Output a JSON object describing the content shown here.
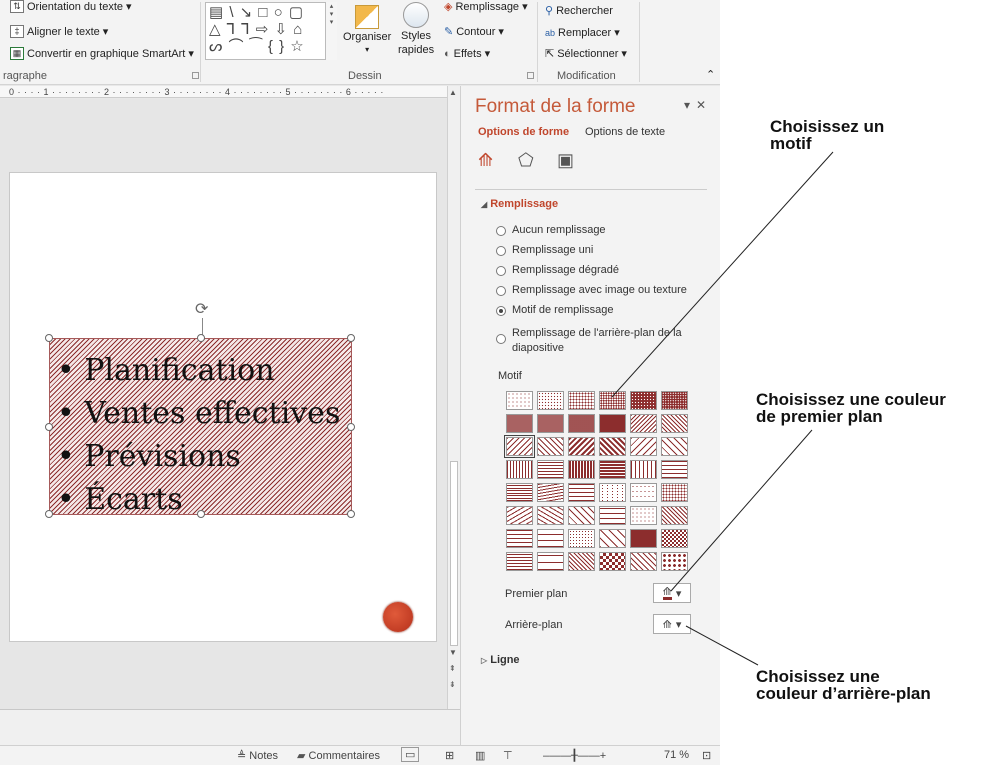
{
  "ribbon": {
    "orientation": "Orientation du texte",
    "align_text": "Aligner le texte",
    "smartart": "Convertir en graphique SmartArt",
    "group_paragraph": "ragraphe",
    "shapes_row1": "▤ \\ ↘ □ ○ ▢",
    "shapes_row2": "△ ⅂ ⅂ ⇨ ⇩ ⌂",
    "shapes_row3": "ᔕ ⌒ ⁀ { } ☆",
    "organize": "Organiser",
    "styles_rapides_1": "Styles",
    "styles_rapides_2": "rapides",
    "fill": "Remplissage",
    "outline": "Contour",
    "effects": "Effets",
    "group_drawing": "Dessin",
    "find": "Rechercher",
    "replace": "Remplacer",
    "select": "Sélectionner",
    "group_editing": "Modification"
  },
  "ruler": "0 · · · · 1 · · · · · · · · 2 · · · · · · · · 3 · · · · · · · · 4 · · · · · · · · 5 · · · · · · · · 6 · · · · ·",
  "slide": {
    "bullets": [
      "Planification",
      "Ventes effectives",
      "Prévisions",
      "Écarts"
    ]
  },
  "status": {
    "notes": "Notes",
    "comments": "Commentaires",
    "zoom": "71 %"
  },
  "pane": {
    "title": "Format de la forme",
    "tab_shape": "Options de forme",
    "tab_text": "Options de texte",
    "section_fill": "Remplissage",
    "options": [
      "Aucun remplissage",
      "Remplissage uni",
      "Remplissage dégradé",
      "Remplissage avec image ou texture",
      "Motif de remplissage",
      "Remplissage de l'arrière-plan de la diapositive"
    ],
    "selected_option": "Motif de remplissage",
    "motif_label": "Motif",
    "foreground_label": "Premier plan",
    "background_label": "Arrière-plan",
    "section_line": "Ligne",
    "pattern_color": "#8c2d2d",
    "accent_color": "#c0462c"
  },
  "annotations": {
    "motif": "Choisissez un\nmotif",
    "foreground": "Choisissez une couleur\nde premier plan",
    "background": "Choisissez une\ncouleur d’arrière-plan"
  }
}
